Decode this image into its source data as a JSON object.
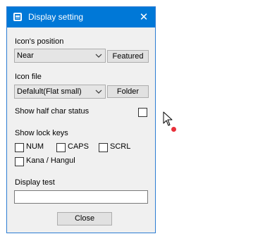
{
  "window": {
    "title": "Display setting",
    "close_glyph": "✕"
  },
  "icon_position": {
    "label": "Icon's position",
    "selected": "Near",
    "featured_button": "Featured"
  },
  "icon_file": {
    "label": "Icon file",
    "selected": "Defalult(Flat small)",
    "folder_button": "Folder"
  },
  "half_char": {
    "label": "Show half char status",
    "checked": false
  },
  "lock_keys": {
    "label": "Show lock keys",
    "num": "NUM",
    "caps": "CAPS",
    "scrl": "SCRL",
    "kana": "Kana / Hangul"
  },
  "display_test": {
    "label": "Display test",
    "value": ""
  },
  "footer": {
    "close_button": "Close"
  },
  "colors": {
    "titlebar": "#0078d7",
    "window_bg": "#f0f0f0",
    "cursor_dot": "#e8303a"
  },
  "icons": {
    "app": "display-setting-app-icon",
    "close": "close-icon",
    "dropdown": "chevron-down-icon",
    "pointer": "mouse-pointer-icon"
  }
}
